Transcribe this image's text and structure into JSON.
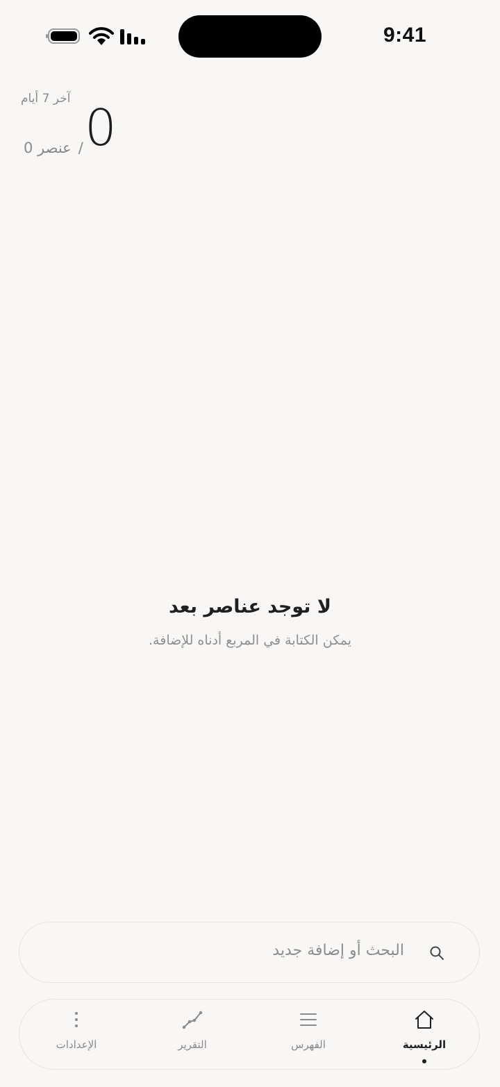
{
  "status_bar": {
    "time": "9:41"
  },
  "summary": {
    "range_label": "آخر 7 أيام",
    "count": "0",
    "separator": "/",
    "total_label": "0 عنصر"
  },
  "empty_state": {
    "title": "لا توجد عناصر بعد",
    "subtitle": "يمكن الكتابة في المربع أدناه للإضافة."
  },
  "search": {
    "placeholder": "البحث أو إضافة جديد"
  },
  "tabs": [
    {
      "label": "الرئيسية",
      "icon": "home-icon",
      "active": true
    },
    {
      "label": "الفهرس",
      "icon": "list-icon",
      "active": false
    },
    {
      "label": "التقرير",
      "icon": "chart-line-icon",
      "active": false
    },
    {
      "label": "الإعدادات",
      "icon": "more-vertical-icon",
      "active": false
    }
  ]
}
